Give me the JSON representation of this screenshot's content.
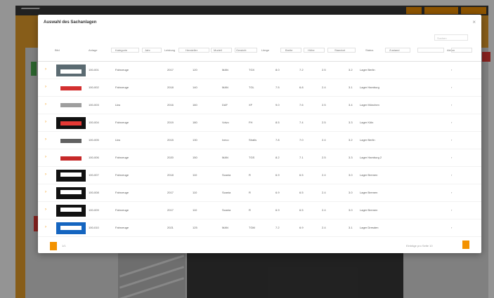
{
  "app": {
    "colors": {
      "accent": "#f39200",
      "rail": "#e8a02b",
      "topbar": "#3a3a3a",
      "green": "#4caf50",
      "red": "#e53935"
    }
  },
  "modal": {
    "title": "Auswahl des Sachanlagen",
    "close_icon": "close-icon",
    "search_placeholder": "Suchen",
    "columns": [
      "Bild",
      "Anlage",
      "Kategorie",
      "Jahr",
      "Leistung",
      "Hersteller",
      "Modell",
      "Gewicht",
      "Länge",
      "Breite",
      "Höhe",
      "Standort",
      "Status",
      "Zustand",
      "Aktion"
    ],
    "rows": [
      {
        "thumb": "vehicle-image",
        "id": "100-001",
        "category": "Fahrzeuge",
        "c3": "2017",
        "c4": "120",
        "c5": "MAN",
        "c6": "TGX",
        "c7": "8.0",
        "c8": "7.2",
        "c9": "2.5",
        "c10": "3.2",
        "location": "Lager Berlin",
        "action": "›"
      },
      {
        "thumb": "vehicle-image",
        "id": "100-002",
        "category": "Fahrzeuge",
        "c3": "2018",
        "c4": "140",
        "c5": "MAN",
        "c6": "TGL",
        "c7": "7.5",
        "c8": "6.8",
        "c9": "2.4",
        "c10": "3.1",
        "location": "Lager Hamburg",
        "action": "›"
      },
      {
        "thumb": "vehicle-image",
        "id": "100-003",
        "category": "Lkw",
        "c3": "2016",
        "c4": "160",
        "c5": "DAF",
        "c6": "XF",
        "c7": "9.0",
        "c8": "7.6",
        "c9": "2.5",
        "c10": "3.4",
        "location": "Lager München",
        "action": "›"
      },
      {
        "thumb": "vehicle-image",
        "id": "100-004",
        "category": "Fahrzeuge",
        "c3": "2019",
        "c4": "180",
        "c5": "Volvo",
        "c6": "FH",
        "c7": "8.5",
        "c8": "7.4",
        "c9": "2.5",
        "c10": "3.3",
        "location": "Lager Köln",
        "action": "›"
      },
      {
        "thumb": "vehicle-image",
        "id": "100-005",
        "category": "Lkw",
        "c3": "2015",
        "c4": "130",
        "c5": "Iveco",
        "c6": "Stralis",
        "c7": "7.8",
        "c8": "7.0",
        "c9": "2.4",
        "c10": "3.2",
        "location": "Lager Berlin",
        "action": "›"
      },
      {
        "thumb": "vehicle-image",
        "id": "100-006",
        "category": "Fahrzeuge",
        "c3": "2020",
        "c4": "150",
        "c5": "MAN",
        "c6": "TGS",
        "c7": "8.2",
        "c8": "7.1",
        "c9": "2.5",
        "c10": "3.3",
        "location": "Lager Hamburg 2",
        "action": "›"
      },
      {
        "thumb": "vehicle-image",
        "id": "100-007",
        "category": "Fahrzeuge",
        "c3": "2018",
        "c4": "110",
        "c5": "Scania",
        "c6": "R",
        "c7": "6.9",
        "c8": "6.5",
        "c9": "2.4",
        "c10": "3.0",
        "location": "Lager Bremen",
        "action": "›"
      },
      {
        "thumb": "vehicle-image",
        "id": "100-008",
        "category": "Fahrzeuge",
        "c3": "2017",
        "c4": "110",
        "c5": "Scania",
        "c6": "R",
        "c7": "6.9",
        "c8": "6.5",
        "c9": "2.4",
        "c10": "3.0",
        "location": "Lager Bremen",
        "action": "›"
      },
      {
        "thumb": "vehicle-image",
        "id": "100-009",
        "category": "Fahrzeuge",
        "c3": "2017",
        "c4": "110",
        "c5": "Scania",
        "c6": "R",
        "c7": "6.9",
        "c8": "6.5",
        "c9": "2.4",
        "c10": "3.0",
        "location": "Lager Bremen",
        "action": "›"
      },
      {
        "thumb": "vehicle-image",
        "id": "100-010",
        "category": "Fahrzeuge",
        "c3": "2021",
        "c4": "125",
        "c5": "MAN",
        "c6": "TGM",
        "c7": "7.2",
        "c8": "6.9",
        "c9": "2.4",
        "c10": "3.1",
        "location": "Lager Dresden",
        "action": "›"
      }
    ],
    "pager": {
      "left_text": "1/1",
      "right_text": "Einträge pro Seite 10"
    }
  }
}
